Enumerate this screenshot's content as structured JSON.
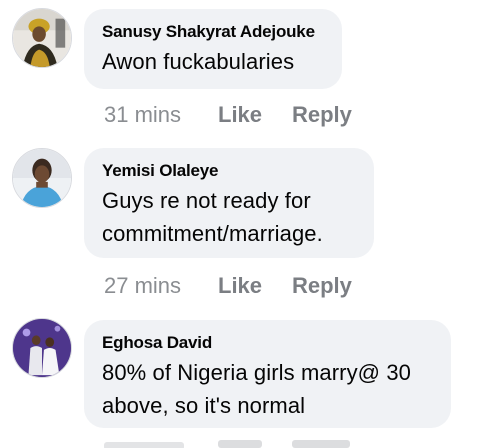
{
  "comments": [
    {
      "author": "Sanusy Shakyrat Adejouke",
      "text_lines": [
        "Awon fuckabularies"
      ],
      "time": "31 mins",
      "like_label": "Like",
      "reply_label": "Reply",
      "avatar_icon": "profile-photo-woman-headwrap"
    },
    {
      "author": "Yemisi Olaleye",
      "text_lines": [
        "Guys re not ready for",
        "commitment/marriage."
      ],
      "time": "27 mins",
      "like_label": "Like",
      "reply_label": "Reply",
      "avatar_icon": "profile-photo-woman-selfie"
    },
    {
      "author": "Eghosa David",
      "text_lines": [
        "80% of Nigeria girls marry@ 30",
        "above, so it's normal"
      ],
      "time": "",
      "like_label": "",
      "reply_label": "",
      "avatar_icon": "profile-photo-couple-wedding"
    }
  ],
  "colors": {
    "bubble": "#f0f2f5",
    "text": "#050505",
    "meta": "#8a8d91"
  }
}
